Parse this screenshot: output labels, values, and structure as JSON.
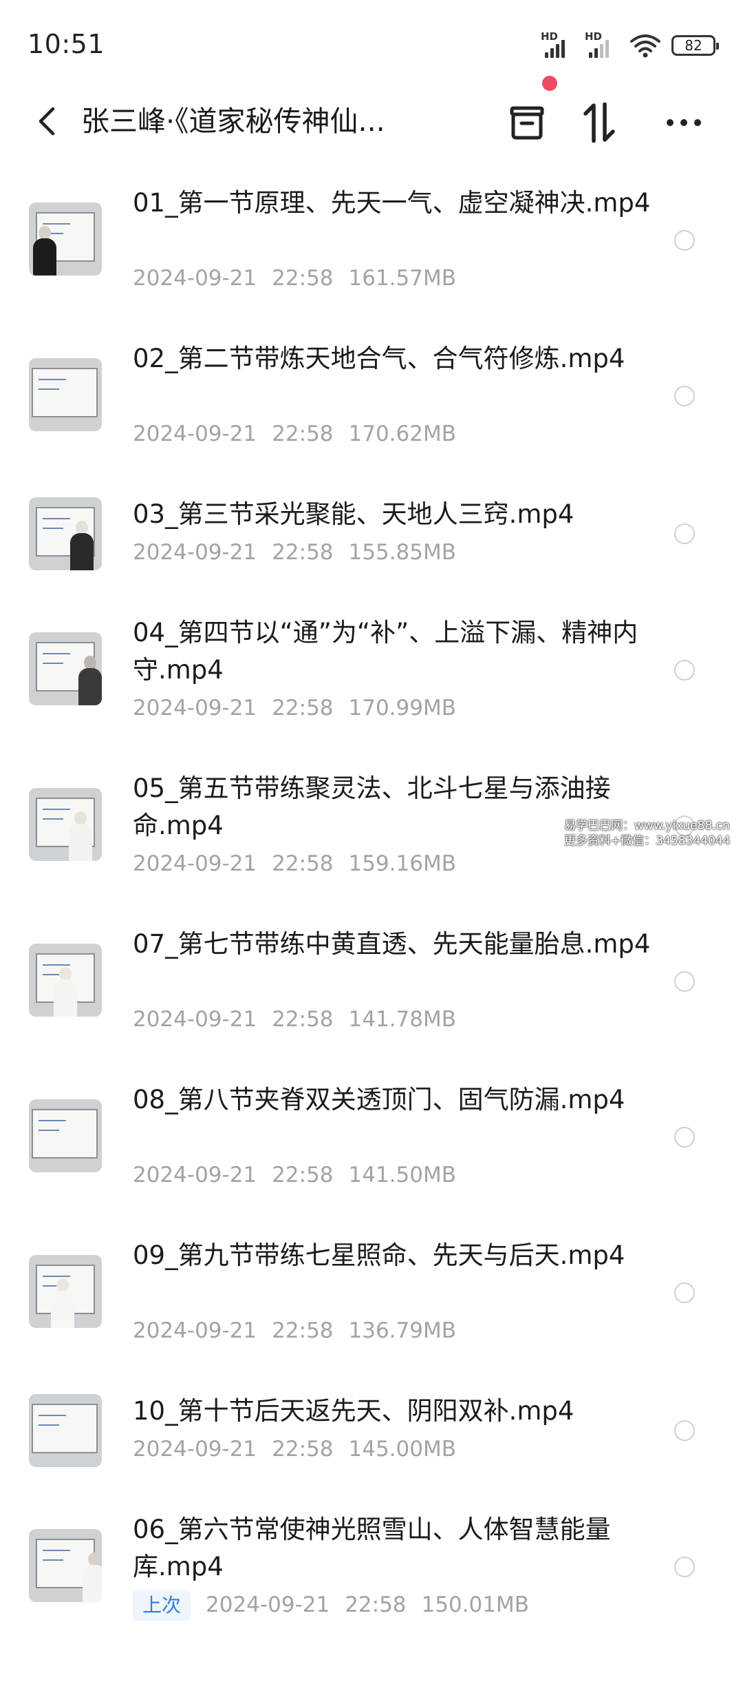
{
  "status_bar": {
    "time": "10:51",
    "signal_label": "HD",
    "battery": "82"
  },
  "header": {
    "title": "张三峰·《道家秘传神仙...",
    "icons": [
      "back-arrow-icon",
      "collect-box-icon",
      "sort-icon",
      "more-icon"
    ],
    "notification_dot_color": "#ef4a62"
  },
  "files": [
    {
      "name": "01_第一节原理、先天一气、虚空凝神决.mp4",
      "date": "2024-09-21",
      "time": "22:58",
      "size": "161.57MB",
      "tag": ""
    },
    {
      "name": "02_第二节带炼天地合气、合气符修炼.mp4",
      "date": "2024-09-21",
      "time": "22:58",
      "size": "170.62MB",
      "tag": ""
    },
    {
      "name": "03_第三节采光聚能、天地人三窍.mp4",
      "date": "2024-09-21",
      "time": "22:58",
      "size": "155.85MB",
      "tag": ""
    },
    {
      "name": "04_第四节以“通”为“补”、上溢下漏、精神内守.mp4",
      "date": "2024-09-21",
      "time": "22:58",
      "size": "170.99MB",
      "tag": ""
    },
    {
      "name": "05_第五节带练聚灵法、北斗七星与添油接命.mp4",
      "date": "2024-09-21",
      "time": "22:58",
      "size": "159.16MB",
      "tag": ""
    },
    {
      "name": "07_第七节带练中黄直透、先天能量胎息.mp4",
      "date": "2024-09-21",
      "time": "22:58",
      "size": "141.78MB",
      "tag": ""
    },
    {
      "name": "08_第八节夹脊双关透顶门、固气防漏.mp4",
      "date": "2024-09-21",
      "time": "22:58",
      "size": "141.50MB",
      "tag": ""
    },
    {
      "name": "09_第九节带练七星照命、先天与后天.mp4",
      "date": "2024-09-21",
      "time": "22:58",
      "size": "136.79MB",
      "tag": ""
    },
    {
      "name": "10_第十节后天返先天、阴阳双补.mp4",
      "date": "2024-09-21",
      "time": "22:58",
      "size": "145.00MB",
      "tag": ""
    },
    {
      "name": "06_第六节常使神光照雪山、人体智慧能量库.mp4",
      "date": "2024-09-21",
      "time": "22:58",
      "size": "150.01MB",
      "tag": "上次"
    }
  ],
  "watermark": {
    "line1": "易学巴巴网：www.yixue88.cn",
    "line2": "更多资料+微信：3458344044"
  },
  "colors": {
    "accent": "#2f7de1",
    "meta_text": "#a3a3a3",
    "title_text": "#1b1b1b"
  }
}
